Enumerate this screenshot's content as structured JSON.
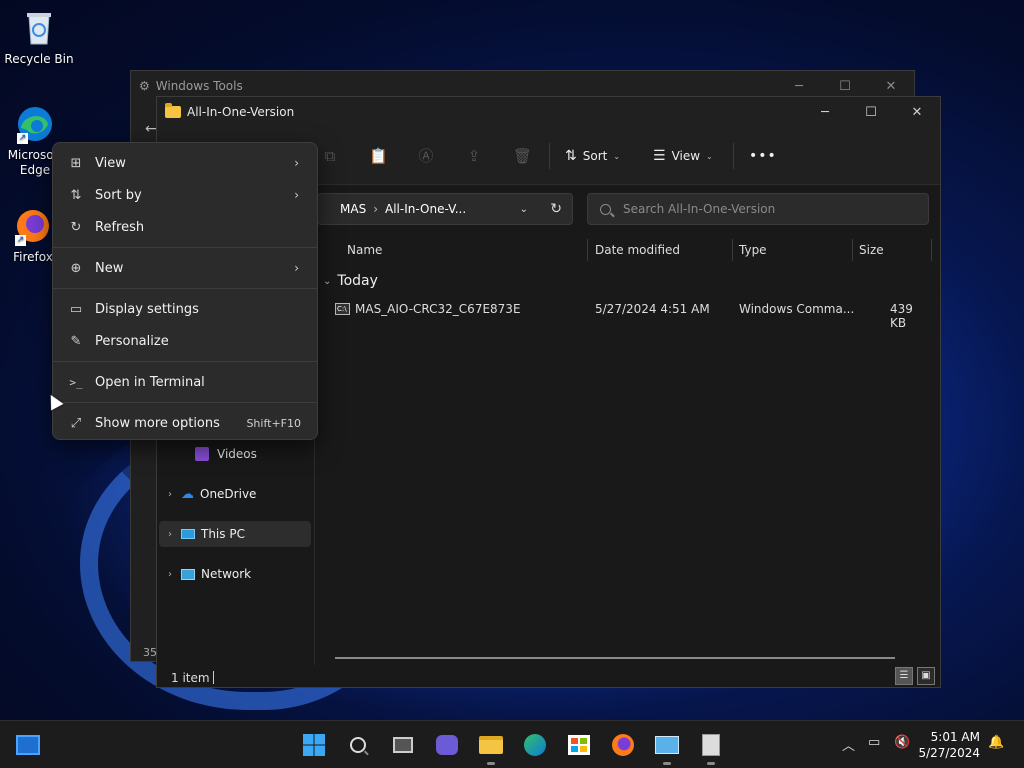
{
  "desktop": {
    "icons": [
      {
        "label": "Recycle Bin"
      },
      {
        "label": "Microsoft Edge"
      },
      {
        "label": "Firefox"
      }
    ]
  },
  "tools_window": {
    "title": "Windows Tools",
    "status_fragment": "35"
  },
  "explorer": {
    "title": "All-In-One-Version",
    "toolbar": {
      "sort_label": "Sort",
      "view_label": "View",
      "more_label": "•••"
    },
    "address": {
      "crumbs": [
        "MAS",
        "All-In-One-V..."
      ]
    },
    "search": {
      "placeholder": "Search All-In-One-Version"
    },
    "nav": [
      {
        "label": "Videos"
      },
      {
        "label": "OneDrive"
      },
      {
        "label": "This PC"
      },
      {
        "label": "Network"
      }
    ],
    "columns": [
      "Name",
      "Date modified",
      "Type",
      "Size"
    ],
    "group_label": "Today",
    "files": [
      {
        "name": "MAS_AIO-CRC32_C67E873E",
        "date": "5/27/2024 4:51 AM",
        "type": "Windows Comma...",
        "size": "439 KB"
      }
    ],
    "status": "1 item"
  },
  "context_menu": {
    "items": [
      {
        "label": "View",
        "icon": "grid-icon"
      },
      {
        "label": "Sort by",
        "icon": "sort-icon"
      },
      {
        "label": "Refresh",
        "icon": "refresh-icon"
      },
      {
        "label": "New",
        "icon": "plus-circle-icon"
      },
      {
        "label": "Display settings",
        "icon": "display-icon"
      },
      {
        "label": "Personalize",
        "icon": "brush-icon"
      },
      {
        "label": "Open in Terminal",
        "icon": "terminal-icon"
      },
      {
        "label": "Show more options",
        "icon": "expand-icon",
        "shortcut": "Shift+F10"
      }
    ]
  },
  "taskbar": {
    "clock_time": "5:01 AM",
    "clock_date": "5/27/2024"
  },
  "colors": {
    "accent": "#0078d4",
    "folder": "#f4c542",
    "menu_bg": "#2b2b2b"
  }
}
